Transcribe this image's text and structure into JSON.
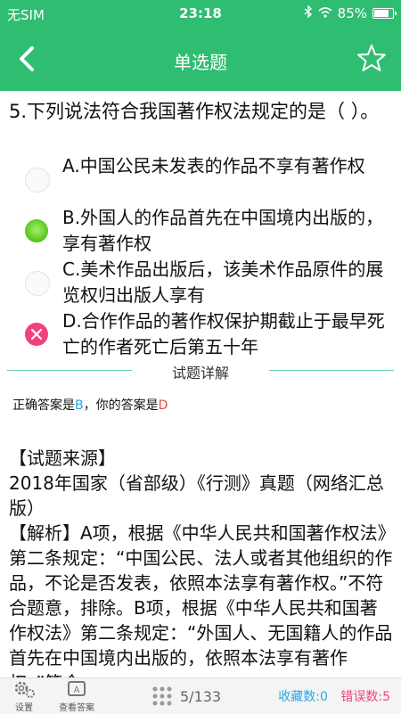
{
  "status": {
    "carrier": "无SIM",
    "time": "23:18",
    "battery": "85%"
  },
  "nav": {
    "title": "单选题"
  },
  "question": "5.下列说法符合我国著作权法规定的是（ ）。",
  "options": [
    {
      "text": "A.中国公民未发表的作品不享有著作权",
      "state": "empty"
    },
    {
      "text": "B.外国人的作品首先在中国境内出版的，享有著作权",
      "state": "correct"
    },
    {
      "text": "C.美术作品出版后，该美术作品原件的展览权归出版人享有",
      "state": "empty"
    },
    {
      "text": "D.合作作品的著作权保护期截止于最早死亡的作者死亡后第五十年",
      "state": "wrong"
    }
  ],
  "detail_label": "试题详解",
  "answer": {
    "prefix": "正确答案是",
    "correct": "B",
    "middle": "，你的答案是",
    "yours": "D"
  },
  "explanation": {
    "source_heading": "【试题来源】",
    "source": "2018年国家（省部级）《行测》真题（网络汇总版）",
    "analysis": "【解析】A项，根据《中华人民共和国著作权法》第二条规定：“中国公民、法人或者其他组织的作品，不论是否发表，依照本法享有著作权。”不符合题意，排除。B项，根据《中华人民共和国著作权法》第二条规定：“外国人、无国籍人的作品首先在中国境内出版的，依照本法享有著作权。”符合"
  },
  "bottom": {
    "settings": "设置",
    "view_answer": "查看答案",
    "page": "5/133",
    "fav": "收藏数:0",
    "wrong_count": "错误数:5"
  },
  "colors": {
    "brand": "#2fbd72",
    "correct": "#53c41a",
    "wrong": "#f0437d",
    "link": "#2aa7e0"
  }
}
